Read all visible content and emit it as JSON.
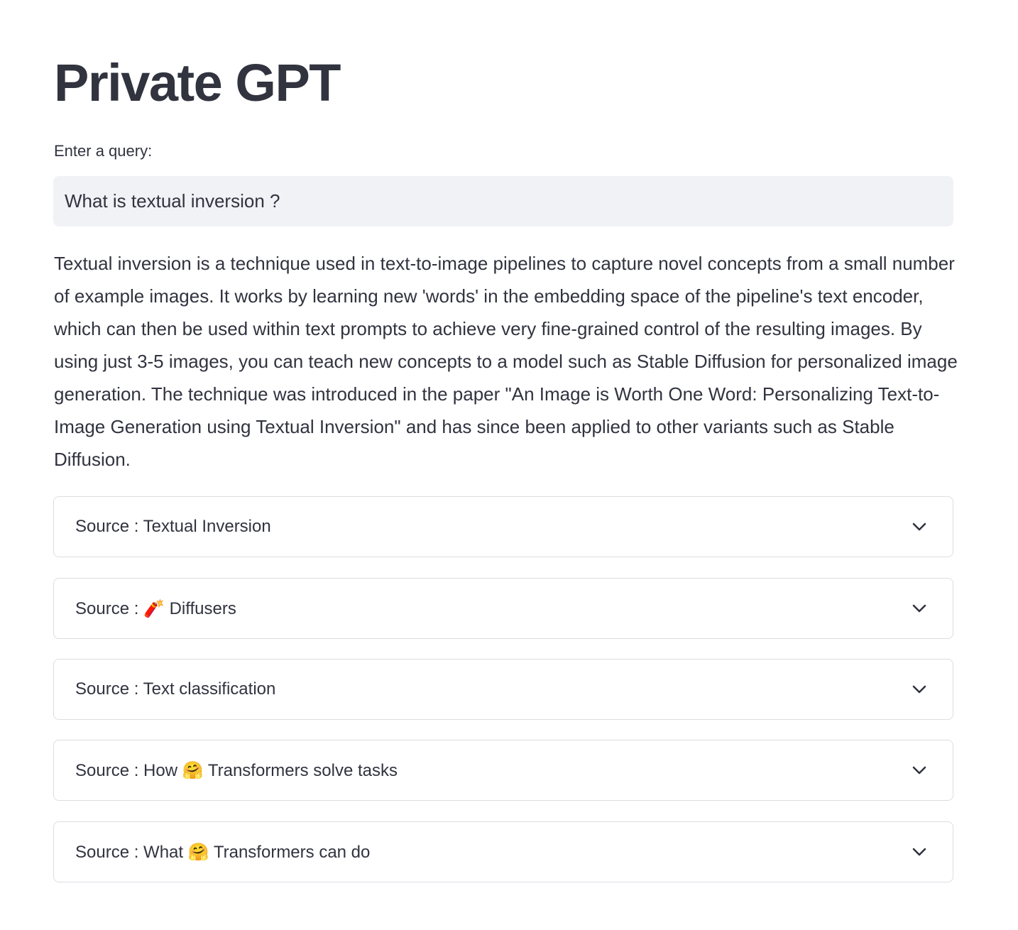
{
  "page": {
    "title": "Private GPT"
  },
  "query": {
    "label": "Enter a query:",
    "value": "What is textual inversion ?"
  },
  "answer": {
    "text": "Textual inversion is a technique used in text-to-image pipelines to capture novel concepts from a small number of example images. It works by learning new 'words' in the embedding space of the pipeline's text encoder, which can then be used within text prompts to achieve very fine-grained control of the resulting images. By using just 3-5 images, you can teach new concepts to a model such as Stable Diffusion for personalized image generation. The technique was introduced in the paper \"An Image is Worth One Word: Personalizing Text-to-Image Generation using Textual Inversion\" and has since been applied to other variants such as Stable Diffusion."
  },
  "sources": [
    {
      "label": "Source : Textual Inversion",
      "icon": "chevron-down-icon",
      "expanded": false
    },
    {
      "label": "Source : 🧨 Diffusers",
      "icon": "chevron-down-icon",
      "expanded": false
    },
    {
      "label": "Source : Text classification",
      "icon": "chevron-down-icon",
      "expanded": false
    },
    {
      "label": "Source : How 🤗 Transformers solve tasks",
      "icon": "chevron-down-icon",
      "expanded": false
    },
    {
      "label": "Source : What 🤗 Transformers can do",
      "icon": "chevron-down-icon",
      "expanded": false
    }
  ],
  "colors": {
    "text": "#31333f",
    "input_background": "#f0f2f6",
    "expander_border": "#dcdde3",
    "background": "#ffffff"
  }
}
